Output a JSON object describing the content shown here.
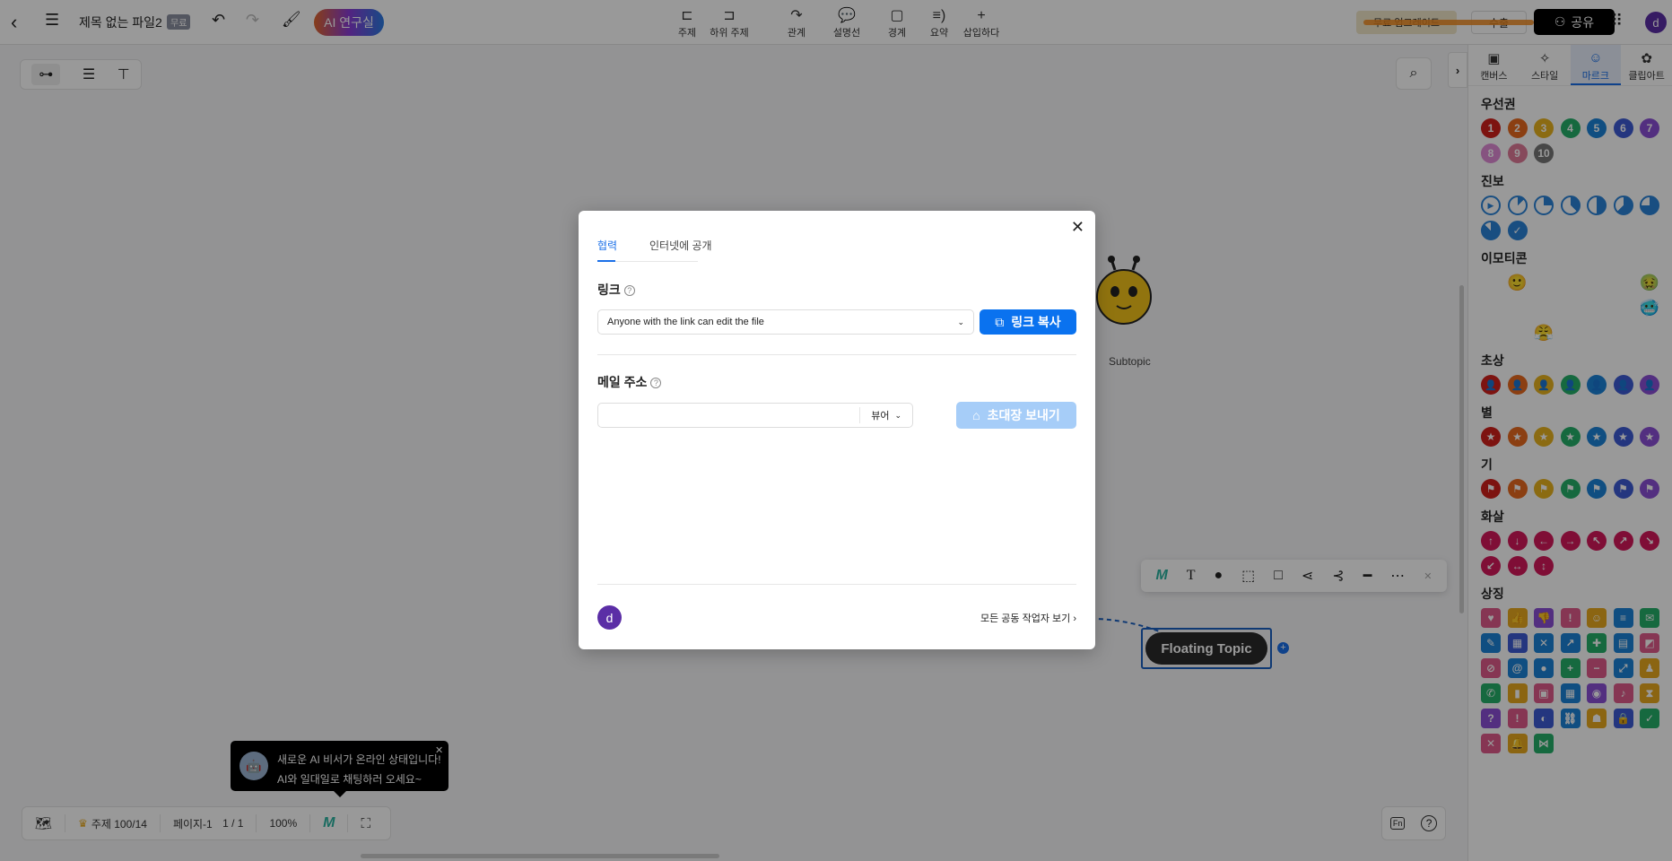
{
  "topbar": {
    "title": "제목 없는 파일2",
    "badge": "무료",
    "ai_lab": "AI 연구실",
    "tools": [
      {
        "icon": "topic-icon",
        "glyph": "⊏",
        "label": "주제"
      },
      {
        "icon": "subtopic-icon",
        "glyph": "⊐",
        "label": "하위 주제"
      },
      {
        "icon": "relation-icon",
        "glyph": "↷",
        "label": "관계"
      },
      {
        "icon": "callout-icon",
        "glyph": "💬",
        "label": "설명선"
      },
      {
        "icon": "boundary-icon",
        "glyph": "▢",
        "label": "경계"
      },
      {
        "icon": "summary-icon",
        "glyph": "≡)",
        "label": "요약"
      },
      {
        "icon": "insert-icon",
        "glyph": "+",
        "label": "삽입하다"
      }
    ],
    "upgrade": "무료 업그레이드",
    "export": "수출",
    "share": "공유",
    "avatar": "d"
  },
  "right_panel": {
    "tabs": [
      {
        "icon": "canvas-icon",
        "glyph": "▣",
        "label": "캔버스"
      },
      {
        "icon": "style-icon",
        "glyph": "✧",
        "label": "스타일"
      },
      {
        "icon": "mark-icon",
        "glyph": "☺",
        "label": "마르크",
        "active": true
      },
      {
        "icon": "clipart-icon",
        "glyph": "✿",
        "label": "클립아트"
      }
    ],
    "sections": [
      {
        "title": "우선권",
        "type": "num",
        "items": [
          "1",
          "2",
          "3",
          "4",
          "5",
          "6",
          "7",
          "8",
          "9",
          "10"
        ],
        "colors": [
          "#d0201b",
          "#e8691e",
          "#e8b31e",
          "#25b06a",
          "#1b83d8",
          "#3c5bd4",
          "#8b4fd6",
          "#e08ad6",
          "#e07a98",
          "#777777"
        ]
      },
      {
        "title": "진보",
        "type": "progress",
        "items": [
          "start",
          "1/8",
          "1/4",
          "3/8",
          "1/2",
          "5/8",
          "3/4",
          "7/8",
          "done"
        ],
        "colors": [
          "#2a82d8"
        ]
      },
      {
        "title": "이모티콘",
        "type": "emoji",
        "items": [
          "😄",
          "🙂",
          "😑",
          "😟",
          "😡",
          "😭",
          "🤢",
          "😲",
          "😅",
          "😋",
          "😎",
          "😆",
          "😍",
          "🥶",
          "😷",
          "😵",
          "😤",
          "😏"
        ],
        "colors": [
          "#f3b73a"
        ]
      },
      {
        "title": "초상",
        "type": "person",
        "items": [
          "red",
          "orange",
          "yellow",
          "green",
          "blue",
          "indigo",
          "purple"
        ],
        "colors": [
          "#d0201b",
          "#e8691e",
          "#e8b31e",
          "#25b06a",
          "#1b83d8",
          "#3c5bd4",
          "#8b4fd6"
        ]
      },
      {
        "title": "별",
        "type": "star",
        "items": [
          "★",
          "★",
          "★",
          "★",
          "★",
          "★",
          "★"
        ],
        "colors": [
          "#d0201b",
          "#e8691e",
          "#e8b31e",
          "#25b06a",
          "#1b83d8",
          "#3c5bd4",
          "#8b4fd6"
        ]
      },
      {
        "title": "기",
        "type": "flag",
        "items": [
          "⚑",
          "⚑",
          "⚑",
          "⚑",
          "⚑",
          "⚑",
          "⚑"
        ],
        "colors": [
          "#d0201b",
          "#e8691e",
          "#e8b31e",
          "#25b06a",
          "#1b83d8",
          "#3c5bd4",
          "#8b4fd6"
        ]
      },
      {
        "title": "화살",
        "type": "arrow",
        "items": [
          "↑",
          "↓",
          "←",
          "→",
          "↖",
          "↗",
          "↘",
          "↙",
          "↔",
          "↕"
        ],
        "colors": [
          "#d4185a"
        ]
      },
      {
        "title": "상징",
        "type": "symbol",
        "items": [
          "♥",
          "👍",
          "👎",
          "!",
          "☺",
          "≡",
          "✉",
          "✎",
          "▦",
          "✕",
          "↗",
          "✚",
          "▤",
          "◩",
          "⊘",
          "@",
          "●",
          "+",
          "−",
          "⤢",
          "♟",
          "✆",
          "▮",
          "▣",
          "▦",
          "◉",
          "♪",
          "⧗",
          "?",
          "!",
          "◐",
          "⛓",
          "☗",
          "🔒",
          "✓",
          "✕",
          "🔔",
          "⋈"
        ],
        "colors": [
          "#e05a8a",
          "#e8a91e",
          "#8b4fd6",
          "#e05a8a",
          "#e8a91e",
          "#1b83d8",
          "#25b06a",
          "#1b83d8",
          "#3c5bd4",
          "#1b83d8",
          "#1b83d8",
          "#25b06a",
          "#1b83d8",
          "#e05a8a",
          "#e05a8a",
          "#1b83d8",
          "#1b83d8",
          "#25b06a",
          "#e05a8a",
          "#1b83d8",
          "#e8a91e",
          "#25b06a",
          "#e8a91e",
          "#e05a8a",
          "#1b83d8",
          "#8b4fd6",
          "#e05a8a",
          "#e8a91e",
          "#8b4fd6",
          "#e05a8a",
          "#3c5bd4",
          "#1b83d8",
          "#e8a91e",
          "#3c5bd4",
          "#25b06a",
          "#e05a8a",
          "#e8a91e",
          "#25b06a"
        ]
      }
    ]
  },
  "canvas": {
    "subtopic": "Subtopic",
    "floating_topic": "Floating Topic"
  },
  "status_bar": {
    "topics": "주제 100/14",
    "page": "페이지-1",
    "page_count": "1 / 1",
    "zoom": "100%"
  },
  "tooltip": {
    "line1": "새로운 AI 비서가 온라인 상태입니다!",
    "line2": "AI와 일대일로 채팅하러 오세요~"
  },
  "dialog": {
    "tabs": [
      "협력",
      "인터넷에 공개"
    ],
    "link_label": "링크",
    "link_permission": "Anyone with the link can edit the file",
    "copy_link": "링크 복사",
    "email_label": "메일 주소",
    "email_value": "",
    "role": "뷰어",
    "send_invite": "초대장 보내기",
    "avatar": "d",
    "view_all": "모든 공동 작업자 보기"
  }
}
